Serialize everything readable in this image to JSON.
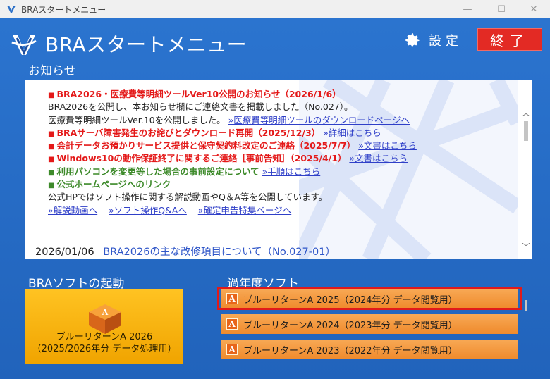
{
  "window": {
    "title": "BRAスタートメニュー"
  },
  "header": {
    "app_title": "BRAスタートメニュー",
    "settings_label": "設定",
    "exit_label": "終了"
  },
  "news": {
    "section_title": "お知らせ",
    "lines": [
      {
        "bullet": "■",
        "text": "BRA2026・医療費等明細ツールVer10公開のお知らせ（2026/1/6）",
        "link": ""
      },
      {
        "bullet": "",
        "text": "BRA2026を公開し、本お知らせ欄にご連絡文書を掲載しました（No.027）。",
        "link": ""
      },
      {
        "bullet": "",
        "text": "医療費等明細ツールVer.10を公開しました。",
        "link": "»医療費等明細ツールのダウンロードページへ"
      },
      {
        "bullet": "■",
        "text": "BRAサーバ障害発生のお詫びとダウンロード再開（2025/12/3）",
        "link": "»詳細はこちら"
      },
      {
        "bullet": "■",
        "text": "会計データお預かりサービス提供と保守契約料改定のご連絡（2025/7/7）",
        "link": "»文書はこちら"
      },
      {
        "bullet": "■",
        "text": "Windows10の動作保証終了に関するご連絡［事前告知］（2025/4/1）",
        "link": "»文書はこちら"
      },
      {
        "bullet": "■",
        "text": "利用パソコンを変更等した場合の事前設定について",
        "link": "»手順はこちら"
      },
      {
        "bullet": "■",
        "text": "公式ホームページへのリンク",
        "link": ""
      },
      {
        "bullet": "",
        "text": "公式HPではソフト操作に関する解説動画やQ＆A等を公開しています。",
        "link": ""
      }
    ],
    "links_row": [
      "»解説動画へ",
      "»ソフト操作Q&Aへ",
      "»確定申告特集ページへ"
    ],
    "footer_date": "2026/01/06",
    "footer_link": "BRA2026の主な改修項目について（No.027-01）"
  },
  "launch": {
    "section_title": "BRAソフトの起動",
    "tile_label_line1": "ブルーリターンA 2026",
    "tile_label_line2": "（2025/2026年分 データ処理用）"
  },
  "past": {
    "section_title": "過年度ソフト",
    "items": [
      "ブルーリターンA 2025（2024年分 データ閲覧用）",
      "ブルーリターンA 2024（2023年分 データ閲覧用）",
      "ブルーリターンA 2023（2022年分 データ閲覧用）"
    ],
    "icon_letter": "A"
  },
  "colors": {
    "background": "#2a6fc8",
    "exit_button": "#e32a24",
    "news_red": "#e41919",
    "news_green": "#3d8a2a",
    "link_blue": "#2f3fc8",
    "tile_orange": "#f0a400",
    "past_item_orange": "#ef8a2c",
    "highlight_red": "#e11a1a"
  }
}
